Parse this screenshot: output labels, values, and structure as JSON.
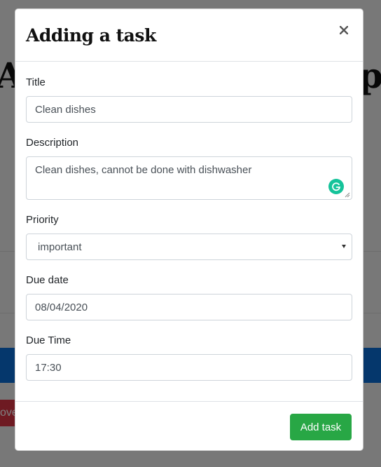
{
  "background": {
    "heading_left": "A",
    "heading_right": "p",
    "red_button_text": "ove"
  },
  "modal": {
    "title": "Adding a task",
    "close_label": "×",
    "fields": {
      "title": {
        "label": "Title",
        "value": "Clean dishes"
      },
      "description": {
        "label": "Description",
        "value": "Clean dishes, cannot be done with dishwasher"
      },
      "priority": {
        "label": "Priority",
        "value": "important"
      },
      "due_date": {
        "label": "Due date",
        "value": "08/04/2020"
      },
      "due_time": {
        "label": "Due Time",
        "value": "17:30"
      }
    },
    "submit_label": "Add task"
  },
  "icons": {
    "close": "close-icon",
    "grammarly": "grammarly-icon",
    "select_caret": "caret-down-icon",
    "resize": "resize-grip-icon"
  },
  "colors": {
    "primary_action": "#28a745",
    "background_blue": "#0a6ed8",
    "background_red": "#dc3545",
    "grammarly": "#15c39a"
  }
}
